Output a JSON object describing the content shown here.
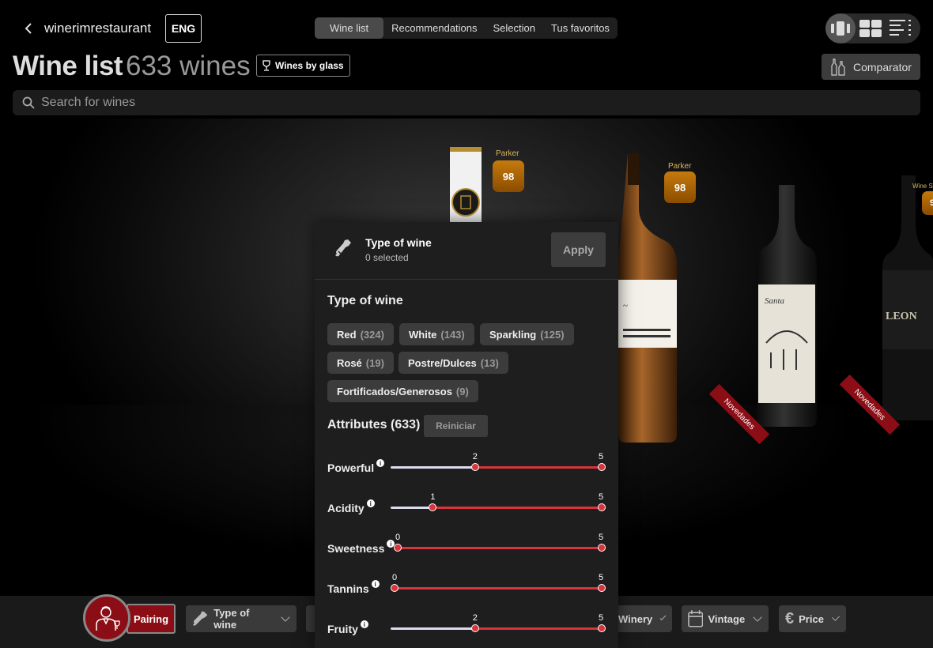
{
  "header": {
    "brand": "winerimrestaurant",
    "language": "ENG",
    "tabs": [
      "Wine list",
      "Recommendations",
      "Selection",
      "Tus favoritos"
    ],
    "active_tab": "Wine list",
    "title": "Wine list",
    "count": "633 wines",
    "wines_by_glass": "Wines by glass",
    "comparator": "Comparator",
    "search_placeholder": "Search for wines",
    "view_modes": [
      "carousel-view",
      "grid-view",
      "list-view"
    ],
    "active_view": "carousel-view"
  },
  "stage": {
    "badges": [
      {
        "label": "Parker",
        "score": "98"
      },
      {
        "label": "Parker",
        "score": "98"
      },
      {
        "label": "Wine S",
        "score": "9"
      }
    ],
    "ribbons": [
      "Novedades",
      "Novedades"
    ]
  },
  "panel": {
    "title": "Type of wine",
    "selected": "0 selected",
    "apply": "Apply",
    "types_title": "Type of wine",
    "types": [
      {
        "name": "Red",
        "count": "(324)"
      },
      {
        "name": "White",
        "count": "(143)"
      },
      {
        "name": "Sparkling",
        "count": "(125)"
      },
      {
        "name": "Rosé",
        "count": "(19)"
      },
      {
        "name": "Postre/Dulces",
        "count": "(13)"
      },
      {
        "name": "Fortificados/Generosos",
        "count": "(9)"
      }
    ],
    "attributes_title": "Attributes (633)",
    "reset": "Reiniciar",
    "attributes": [
      {
        "name": "Powerful",
        "min": 2,
        "max": 5
      },
      {
        "name": "Acidity",
        "min": 1,
        "max": 5
      },
      {
        "name": "Sweetness",
        "min": 0,
        "max": 5
      },
      {
        "name": "Tannins",
        "min": 0,
        "max": 5
      },
      {
        "name": "Fruity",
        "min": 2,
        "max": 5
      }
    ],
    "scale_max": 5
  },
  "bottom_bar": {
    "pairing": "Pairing",
    "filters": [
      "Type of wine",
      "Winery",
      "Vintage",
      "Price"
    ]
  },
  "colors": {
    "accent": "#d9343c",
    "pairing_bg": "#8b0d15",
    "badge": "#c57a0c"
  }
}
